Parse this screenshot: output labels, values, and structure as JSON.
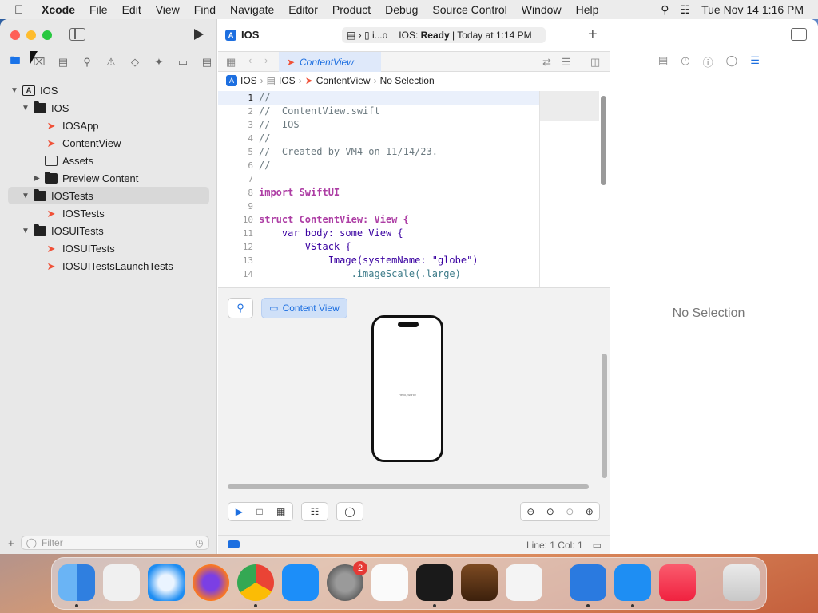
{
  "menubar": {
    "app_name": "Xcode",
    "items": [
      "File",
      "Edit",
      "View",
      "Find",
      "Navigate",
      "Editor",
      "Product",
      "Debug",
      "Source Control",
      "Window",
      "Help"
    ],
    "datetime": "Tue Nov 14  1:16 PM"
  },
  "toolbar": {
    "scheme": "IOS",
    "destination": "i...o",
    "status_prefix": "IOS: ",
    "status_state": "Ready",
    "status_time": "| Today at 1:14 PM"
  },
  "tab": {
    "label": "ContentView"
  },
  "jumpbar": {
    "project": "IOS",
    "group": "IOS",
    "file": "ContentView",
    "selection": "No Selection"
  },
  "navigator": {
    "items": [
      {
        "label": "IOS",
        "kind": "project"
      },
      {
        "label": "IOS",
        "kind": "folder"
      },
      {
        "label": "IOSApp",
        "kind": "swift"
      },
      {
        "label": "ContentView",
        "kind": "swift"
      },
      {
        "label": "Assets",
        "kind": "assets"
      },
      {
        "label": "Preview Content",
        "kind": "folder"
      },
      {
        "label": "IOSTests",
        "kind": "folder"
      },
      {
        "label": "IOSTests",
        "kind": "swift"
      },
      {
        "label": "IOSUITests",
        "kind": "folder"
      },
      {
        "label": "IOSUITests",
        "kind": "swift"
      },
      {
        "label": "IOSUITestsLaunchTests",
        "kind": "swift"
      }
    ],
    "filter_placeholder": "Filter"
  },
  "code": {
    "line_numbers": [
      "1",
      "2",
      "3",
      "4",
      "5",
      "6",
      "7",
      "8",
      "9",
      "10",
      "11",
      "12",
      "13",
      "14"
    ],
    "lines": [
      "//",
      "//  ContentView.swift",
      "//  IOS",
      "//",
      "//  Created by VM4 on 11/14/23.",
      "//",
      "",
      "import SwiftUI",
      "",
      "struct ContentView: View {",
      "    var body: some View {",
      "        VStack {",
      "            Image(systemName: \"globe\")",
      "                .imageScale(.large)"
    ]
  },
  "preview": {
    "button_label": "Content View",
    "screen_text": "Hello, world!"
  },
  "statusbar": {
    "position": "Line: 1  Col: 1"
  },
  "inspector": {
    "empty_label": "No Selection"
  },
  "dock": {
    "apps": [
      "Finder",
      "Launchpad",
      "Safari",
      "Firefox",
      "Chrome",
      "App Store",
      "System Settings",
      "TextEdit",
      "Terminal",
      "GarageBand",
      "Visual Studio Code",
      "Xcode",
      "Simulator",
      "Music",
      "Trash"
    ],
    "settings_badge": "2"
  }
}
